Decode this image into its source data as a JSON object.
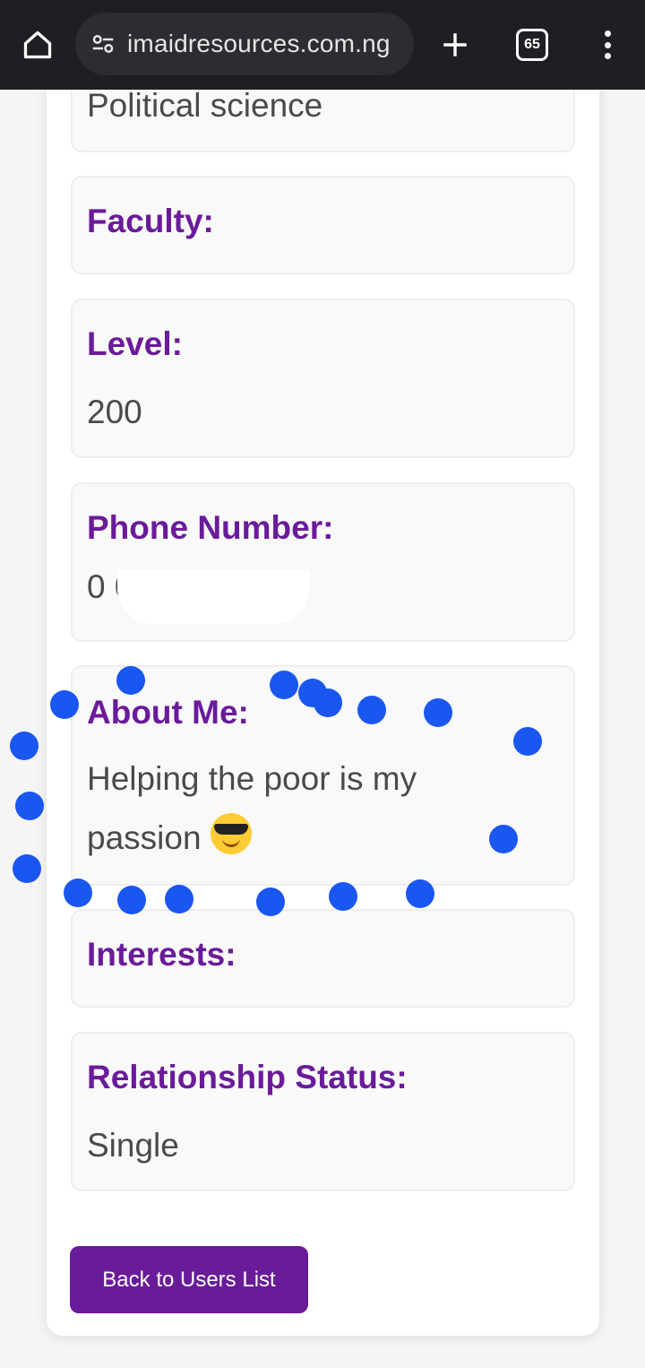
{
  "browser": {
    "url": "imaidresources.com.ng",
    "tab_count": "65"
  },
  "profile": {
    "department_value": "Political science",
    "faculty_label": "Faculty:",
    "faculty_value": "",
    "level_label": "Level:",
    "level_value": "200",
    "phone_label": "Phone Number:",
    "phone_value": "0          0",
    "about_label": "About Me:",
    "about_value": "Helping the poor is my passion",
    "about_emoji": "smiling-face-with-sunglasses",
    "interests_label": "Interests:",
    "interests_value": "",
    "relationship_label": "Relationship Status:",
    "relationship_value": "Single"
  },
  "actions": {
    "back_label": "Back to Users List"
  },
  "colors": {
    "accent": "#6a1b9a",
    "touch_dots": "#1a56f0",
    "chrome_bg": "#1e1f22"
  }
}
